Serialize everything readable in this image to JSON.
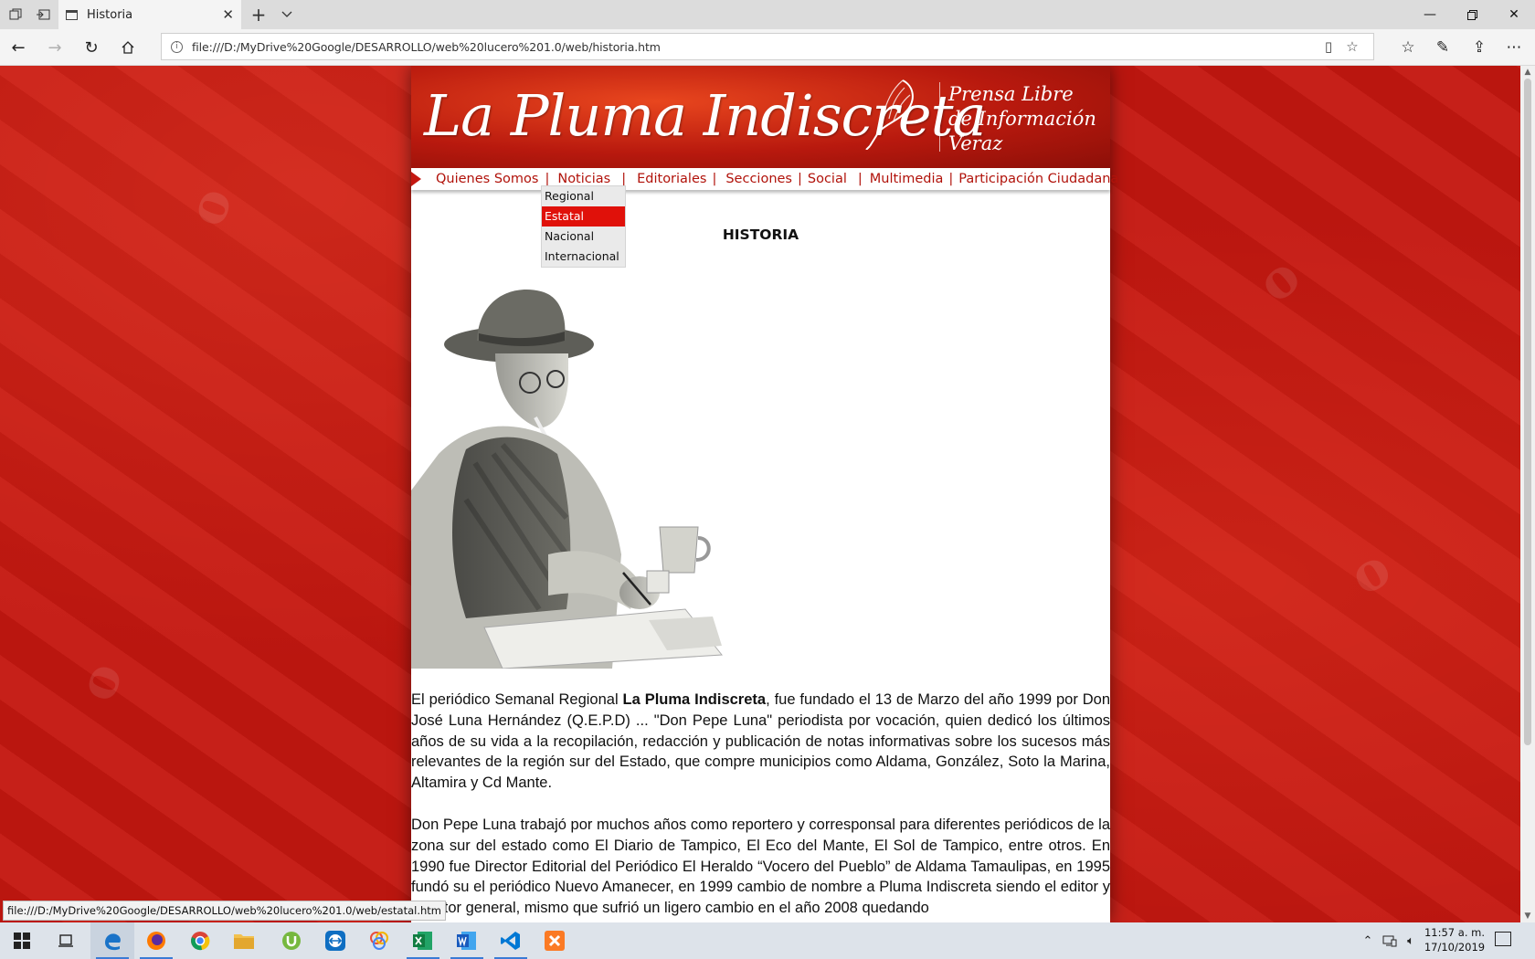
{
  "browser": {
    "tab_title": "Historia",
    "url": "file:///D:/MyDrive%20Google/DESARROLLO/web%20lucero%201.0/web/historia.htm",
    "status_url": "file:///D:/MyDrive%20Google/DESARROLLO/web%20lucero%201.0/web/estatal.htm"
  },
  "site": {
    "logo": "La Pluma Indiscreta",
    "tagline": [
      "Prensa Libre",
      "de Información",
      "Veraz"
    ],
    "menu": [
      {
        "label": "Quienes Somos",
        "sep": "|"
      },
      {
        "label": "Noticias",
        "sep": "|"
      },
      {
        "label": "Editoriales",
        "sep": "|"
      },
      {
        "label": "Secciones",
        "sep": "|"
      },
      {
        "label": "Social",
        "sep": "|"
      },
      {
        "label": "Multimedia",
        "sep": "|"
      },
      {
        "label": "Participación Ciudadana",
        "sep": ""
      }
    ],
    "submenu": [
      "Regional",
      "Estatal",
      "Nacional",
      "Internacional"
    ],
    "submenu_active": "Estatal",
    "page_title": "HISTORIA",
    "article": {
      "p1_a": "El periódico Semanal Regional ",
      "p1_bold": "La Pluma Indiscreta",
      "p1_b": ", fue fundado el 13 de Marzo del año 1999 por Don José Luna Hernández (Q.E.P.D) ... \"Don Pepe Luna\" periodista por vocación, quien dedicó los últimos años de su vida a la recopilación, redacción y publicación de notas informativas sobre los sucesos más relevantes de la región sur del Estado, que compre municipios como Aldama, González, Soto la Marina, Altamira y Cd Mante.",
      "p2": "Don Pepe Luna trabajó por muchos años como reportero y corresponsal para diferentes periódicos de la zona sur del estado como El Diario de Tampico, El Eco del Mante, El Sol de Tampico, entre otros. En 1990 fue Director Editorial del Periódico El Heraldo “Vocero del Pueblo” de Aldama Tamaulipas, en 1995 fundó su el periódico  Nuevo Amanecer, en 1999 cambio de nombre a Pluma Indiscreta siendo el editor y director general, mismo que sufrió un ligero cambio en el año 2008 quedando"
    }
  },
  "taskbar": {
    "time": "11:57 a. m.",
    "date": "17/10/2019"
  },
  "colors": {
    "brand_red": "#c41710",
    "menu_text": "#b1120a",
    "submenu_active": "#e0110a"
  }
}
